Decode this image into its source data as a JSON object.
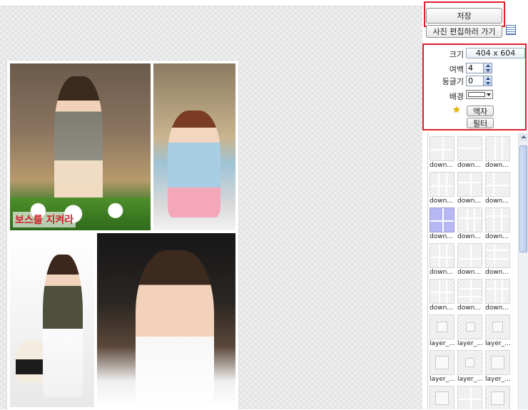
{
  "toolbar": {
    "save_label": "저장",
    "edit_photo_label": "사진 편집하러 가기"
  },
  "settings": {
    "size_label": "크기",
    "size_value": "404 x 604",
    "margin_label": "여백",
    "margin_value": "4",
    "rounding_label": "둥글기",
    "rounding_value": "0",
    "background_label": "배경",
    "background_color": "#ffffff",
    "frame_label": "액자",
    "filter_label": "필터"
  },
  "layouts": [
    {
      "label": "down..."
    },
    {
      "label": "down..."
    },
    {
      "label": "down..."
    },
    {
      "label": "down..."
    },
    {
      "label": "down..."
    },
    {
      "label": "down..."
    },
    {
      "label": "down...",
      "selected": true
    },
    {
      "label": "down..."
    },
    {
      "label": "down..."
    },
    {
      "label": "down..."
    },
    {
      "label": "down..."
    },
    {
      "label": "down..."
    },
    {
      "label": "down..."
    },
    {
      "label": "down..."
    },
    {
      "label": "down..."
    },
    {
      "label": "layer_..."
    },
    {
      "label": "layer_..."
    },
    {
      "label": "layer_..."
    },
    {
      "label": "layer_..."
    },
    {
      "label": "layer_..."
    },
    {
      "label": "layer_..."
    },
    {
      "label": ""
    },
    {
      "label": ""
    },
    {
      "label": ""
    }
  ],
  "collage": {
    "banner_text": "보스를 지켜라"
  },
  "colors": {
    "highlight": "#e01f2b",
    "selected_layout": "#b7b7f4"
  }
}
